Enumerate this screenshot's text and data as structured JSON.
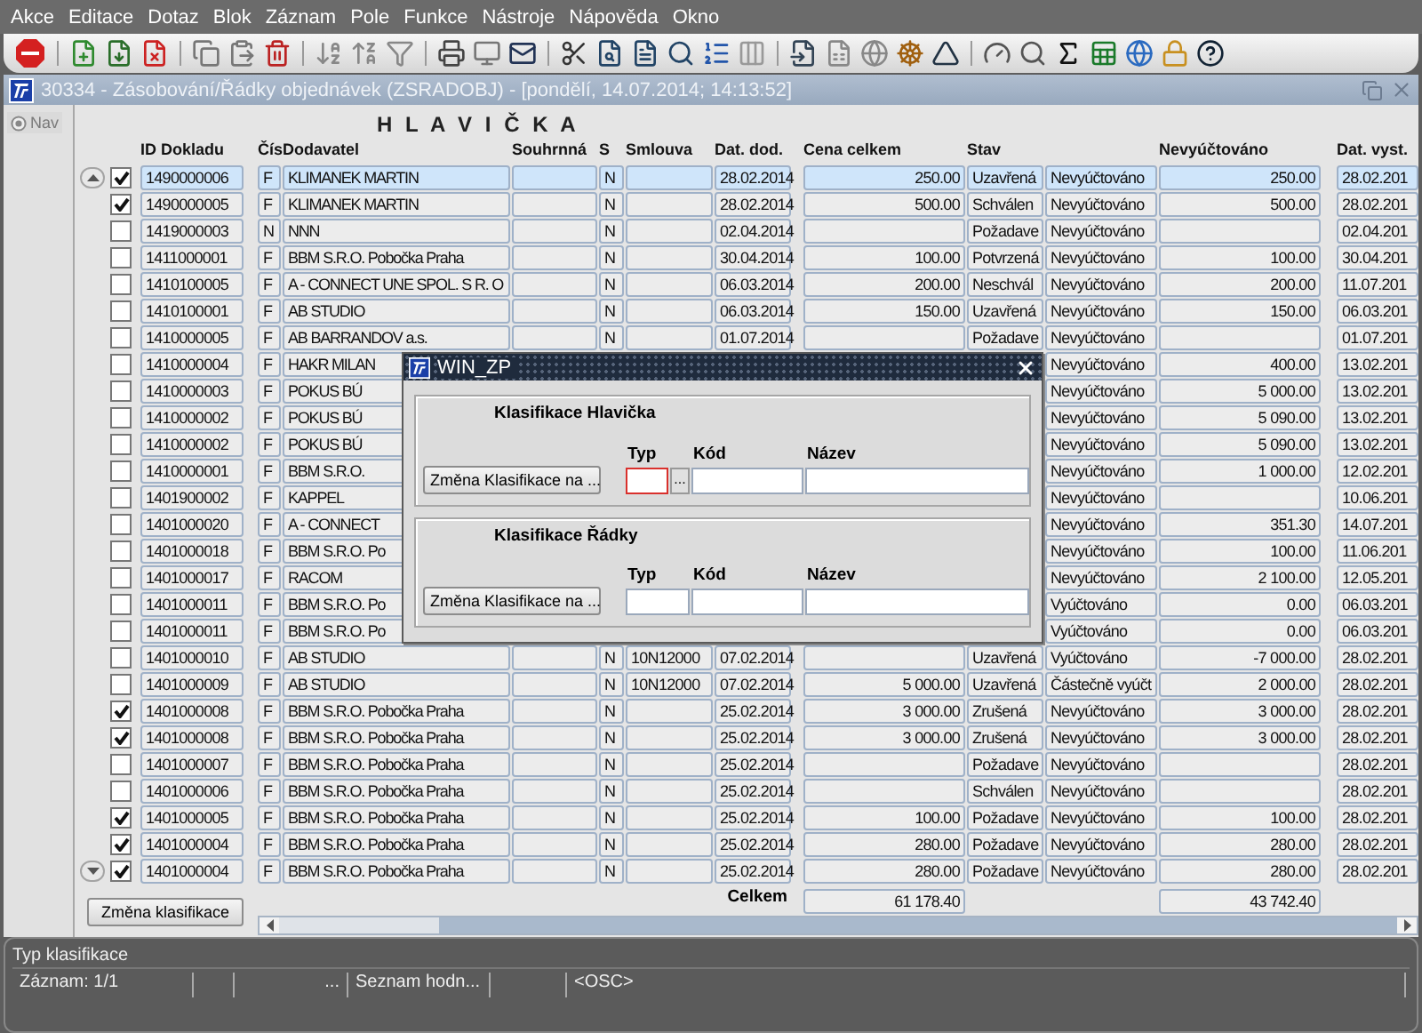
{
  "menu": [
    "Akce",
    "Editace",
    "Dotaz",
    "Blok",
    "Záznam",
    "Pole",
    "Funkce",
    "Nástroje",
    "Nápověda",
    "Okno"
  ],
  "window": {
    "title": "30334 - Zásobování/Řádky objednávek (ZSRADOBJ) - [pondělí, 14.07.2014; 14:13:52]"
  },
  "nav_button": "Nav",
  "heading": "H L A V I Č K A",
  "table": {
    "columns": [
      "ID Dokladu",
      "Čís",
      "Dodavatel",
      "Souhrnná",
      "S",
      "Smlouva",
      "Dat. dod.",
      "Cena celkem",
      "Stav",
      null,
      "Nevyúčtováno",
      "Dat. vyst."
    ],
    "rows": [
      {
        "checked": true,
        "selected": true,
        "cells": [
          "1490000006",
          "F",
          "KLIMANEK MARTIN",
          null,
          "N",
          null,
          "28.02.2014",
          "250.00",
          "Uzavřená",
          "Nevyúčtováno",
          "250.00",
          "28.02.201"
        ]
      },
      {
        "checked": true,
        "selected": false,
        "cells": [
          "1490000005",
          "F",
          "KLIMANEK MARTIN",
          null,
          "N",
          null,
          "28.02.2014",
          "500.00",
          "Schválen",
          "Nevyúčtováno",
          "500.00",
          "28.02.201"
        ]
      },
      {
        "checked": false,
        "selected": false,
        "cells": [
          "1419000003",
          "N",
          "NNN",
          null,
          "N",
          null,
          "02.04.2014",
          null,
          "Požadave",
          "Nevyúčtováno",
          null,
          "02.04.201"
        ]
      },
      {
        "checked": false,
        "selected": false,
        "cells": [
          "1411000001",
          "F",
          "BBM S.R.O. Pobočka Praha",
          null,
          "N",
          null,
          "30.04.2014",
          "100.00",
          "Potvrzená",
          "Nevyúčtováno",
          "100.00",
          "30.04.201"
        ]
      },
      {
        "checked": false,
        "selected": false,
        "cells": [
          "1410100005",
          "F",
          "A - CONNECT UNE SPOL. S R. O",
          null,
          "N",
          null,
          "06.03.2014",
          "200.00",
          "Neschvál",
          "Nevyúčtováno",
          "200.00",
          "11.07.201"
        ]
      },
      {
        "checked": false,
        "selected": false,
        "cells": [
          "1410100001",
          "F",
          "AB STUDIO",
          null,
          "N",
          null,
          "06.03.2014",
          "150.00",
          "Uzavřená",
          "Nevyúčtováno",
          "150.00",
          "06.03.201"
        ]
      },
      {
        "checked": false,
        "selected": false,
        "cells": [
          "1410000005",
          "F",
          "AB BARRANDOV a.s.",
          null,
          "N",
          null,
          "01.07.2014",
          null,
          "Požadave",
          "Nevyúčtováno",
          null,
          "01.07.201"
        ]
      },
      {
        "checked": false,
        "selected": false,
        "cells": [
          "1410000004",
          "F",
          "HAKR MILAN",
          null,
          null,
          null,
          null,
          null,
          null,
          "Nevyúčtováno",
          "400.00",
          "13.02.201"
        ]
      },
      {
        "checked": false,
        "selected": false,
        "cells": [
          "1410000003",
          "F",
          "POKUS BÚ",
          null,
          null,
          null,
          null,
          null,
          null,
          "Nevyúčtováno",
          "5 000.00",
          "13.02.201"
        ]
      },
      {
        "checked": false,
        "selected": false,
        "cells": [
          "1410000002",
          "F",
          "POKUS BÚ",
          null,
          null,
          null,
          null,
          null,
          null,
          "Nevyúčtováno",
          "5 090.00",
          "13.02.201"
        ]
      },
      {
        "checked": false,
        "selected": false,
        "cells": [
          "1410000002",
          "F",
          "POKUS BÚ",
          null,
          null,
          null,
          null,
          null,
          null,
          "Nevyúčtováno",
          "5 090.00",
          "13.02.201"
        ]
      },
      {
        "checked": false,
        "selected": false,
        "cells": [
          "1410000001",
          "F",
          "BBM S.R.O.",
          null,
          null,
          null,
          null,
          null,
          null,
          "Nevyúčtováno",
          "1 000.00",
          "12.02.201"
        ]
      },
      {
        "checked": false,
        "selected": false,
        "cells": [
          "1401900002",
          "F",
          "KAPPEL",
          null,
          null,
          null,
          null,
          null,
          null,
          "Nevyúčtováno",
          null,
          "10.06.201"
        ]
      },
      {
        "checked": false,
        "selected": false,
        "cells": [
          "1401000020",
          "F",
          "A - CONNECT",
          null,
          null,
          null,
          null,
          null,
          null,
          "Nevyúčtováno",
          "351.30",
          "14.07.201"
        ]
      },
      {
        "checked": false,
        "selected": false,
        "cells": [
          "1401000018",
          "F",
          "BBM S.R.O. Po",
          null,
          null,
          null,
          null,
          null,
          null,
          "Nevyúčtováno",
          "100.00",
          "11.06.201"
        ]
      },
      {
        "checked": false,
        "selected": false,
        "cells": [
          "1401000017",
          "F",
          "RACOM",
          null,
          null,
          null,
          null,
          null,
          null,
          "Nevyúčtováno",
          "2 100.00",
          "12.05.201"
        ]
      },
      {
        "checked": false,
        "selected": false,
        "cells": [
          "1401000011",
          "F",
          "BBM S.R.O. Po",
          null,
          null,
          null,
          null,
          null,
          null,
          "Vyúčtováno",
          "0.00",
          "06.03.201"
        ]
      },
      {
        "checked": false,
        "selected": false,
        "cells": [
          "1401000011",
          "F",
          "BBM S.R.O. Po",
          null,
          null,
          null,
          null,
          null,
          null,
          "Vyúčtováno",
          "0.00",
          "06.03.201"
        ]
      },
      {
        "checked": false,
        "selected": false,
        "cells": [
          "1401000010",
          "F",
          "AB STUDIO",
          null,
          "N",
          "10N12000",
          "07.02.2014",
          null,
          "Uzavřená",
          "Vyúčtováno",
          "-7 000.00",
          "28.02.201"
        ]
      },
      {
        "checked": false,
        "selected": false,
        "cells": [
          "1401000009",
          "F",
          "AB STUDIO",
          null,
          "N",
          "10N12000",
          "07.02.2014",
          "5 000.00",
          "Uzavřená",
          "Částečně vyúčt",
          "2 000.00",
          "28.02.201"
        ]
      },
      {
        "checked": true,
        "selected": false,
        "cells": [
          "1401000008",
          "F",
          "BBM S.R.O. Pobočka Praha",
          null,
          "N",
          null,
          "25.02.2014",
          "3 000.00",
          "Zrušená",
          "Nevyúčtováno",
          "3 000.00",
          "28.02.201"
        ]
      },
      {
        "checked": true,
        "selected": false,
        "cells": [
          "1401000008",
          "F",
          "BBM S.R.O. Pobočka Praha",
          null,
          "N",
          null,
          "25.02.2014",
          "3 000.00",
          "Zrušená",
          "Nevyúčtováno",
          "3 000.00",
          "28.02.201"
        ]
      },
      {
        "checked": false,
        "selected": false,
        "cells": [
          "1401000007",
          "F",
          "BBM S.R.O. Pobočka Praha",
          null,
          "N",
          null,
          "25.02.2014",
          null,
          "Požadave",
          "Nevyúčtováno",
          null,
          "28.02.201"
        ]
      },
      {
        "checked": false,
        "selected": false,
        "cells": [
          "1401000006",
          "F",
          "BBM S.R.O. Pobočka Praha",
          null,
          "N",
          null,
          "25.02.2014",
          null,
          "Schválen",
          "Nevyúčtováno",
          null,
          "28.02.201"
        ]
      },
      {
        "checked": true,
        "selected": false,
        "cells": [
          "1401000005",
          "F",
          "BBM S.R.O. Pobočka Praha",
          null,
          "N",
          null,
          "25.02.2014",
          "100.00",
          "Požadave",
          "Nevyúčtováno",
          "100.00",
          "28.02.201"
        ]
      },
      {
        "checked": true,
        "selected": false,
        "cells": [
          "1401000004",
          "F",
          "BBM S.R.O. Pobočka Praha",
          null,
          "N",
          null,
          "25.02.2014",
          "280.00",
          "Požadave",
          "Nevyúčtováno",
          "280.00",
          "28.02.201"
        ]
      },
      {
        "checked": true,
        "selected": false,
        "cells": [
          "1401000004",
          "F",
          "BBM S.R.O. Pobočka Praha",
          null,
          "N",
          null,
          "25.02.2014",
          "280.00",
          "Požadave",
          "Nevyúčtováno",
          "280.00",
          "28.02.201"
        ]
      }
    ],
    "total_label": "Celkem",
    "totals": [
      "61 178.40",
      "43 742.40"
    ]
  },
  "change_button": "Změna klasifikace",
  "dialog": {
    "title": "WIN_ZP",
    "groups": [
      {
        "title": "Klasifikace Hlavička",
        "button": "Změna Klasifikace na ...",
        "lov_button": "...",
        "fields": [
          {
            "label": "Typ",
            "focused": true
          },
          {
            "label": "Kód",
            "focused": false
          },
          {
            "label": "Název",
            "focused": false
          }
        ]
      },
      {
        "title": "Klasifikace Řádky",
        "button": "Změna Klasifikace na ...",
        "fields": [
          {
            "label": "Typ",
            "focused": false
          },
          {
            "label": "Kód",
            "focused": false
          },
          {
            "label": "Název",
            "focused": false
          }
        ]
      }
    ]
  },
  "status_bar": {
    "message": "Typ klasifikace",
    "fields": [
      "Záznam: 1/1",
      "...",
      "Seznam hodn...",
      "<OSC>"
    ]
  }
}
